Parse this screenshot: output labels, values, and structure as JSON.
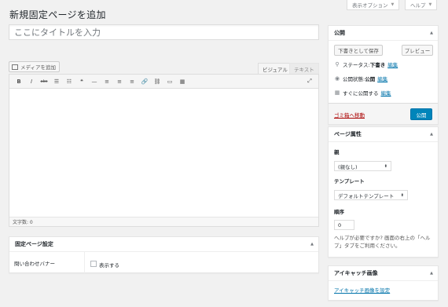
{
  "screen_options": {
    "label": "表示オプション"
  },
  "help_button": {
    "label": "ヘルプ"
  },
  "page_title": "新規固定ページを追加",
  "title_input": {
    "placeholder": "ここにタイトルを入力"
  },
  "media_button": {
    "label": "メディアを追加"
  },
  "editor_tabs": {
    "visual": "ビジュアル",
    "text": "テキスト"
  },
  "toolbar": {
    "buttons": [
      {
        "name": "bold-icon",
        "glyph": "B"
      },
      {
        "name": "italic-icon",
        "glyph": "I"
      },
      {
        "name": "strikethrough-icon",
        "glyph": "abc"
      },
      {
        "name": "bulleted-list-icon",
        "glyph": "☰"
      },
      {
        "name": "numbered-list-icon",
        "glyph": "☷"
      },
      {
        "name": "blockquote-icon",
        "glyph": "❝"
      },
      {
        "name": "horizontal-rule-icon",
        "glyph": "—"
      },
      {
        "name": "align-left-icon",
        "glyph": "≡"
      },
      {
        "name": "align-center-icon",
        "glyph": "≡"
      },
      {
        "name": "align-right-icon",
        "glyph": "≡"
      },
      {
        "name": "insert-link-icon",
        "glyph": "🔗"
      },
      {
        "name": "remove-link-icon",
        "glyph": "⛓"
      },
      {
        "name": "read-more-icon",
        "glyph": "▭"
      },
      {
        "name": "toolbar-toggle-icon",
        "glyph": "▦"
      }
    ],
    "expand_glyph": "⤢"
  },
  "word_count": "文字数: 0",
  "page_settings": {
    "title": "固定ページ設定",
    "field_label": "問い合わせバナー",
    "checkbox_label": "表示する"
  },
  "publish": {
    "title": "公開",
    "save_draft": "下書きとして保存",
    "preview": "プレビュー",
    "status_label": "ステータス:",
    "status_value": "下書き",
    "visibility_label": "公開状態:",
    "visibility_value": "公開",
    "schedule_text": "すぐに公開する",
    "edit": "編集",
    "trash": "ゴミ箱へ移動",
    "publish_button": "公開",
    "accent": "#0085ba"
  },
  "attributes": {
    "title": "ページ属性",
    "parent_label": "親",
    "parent_value": "(親なし)",
    "template_label": "テンプレート",
    "template_value": "デフォルトテンプレート",
    "order_label": "順序",
    "order_value": "0",
    "help_text": "ヘルプが必要ですか? 画面の右上の「ヘルプ」タブをご利用ください。"
  },
  "featured_image": {
    "title": "アイキャッチ画像",
    "set_link": "アイキャッチ画像を設定"
  }
}
